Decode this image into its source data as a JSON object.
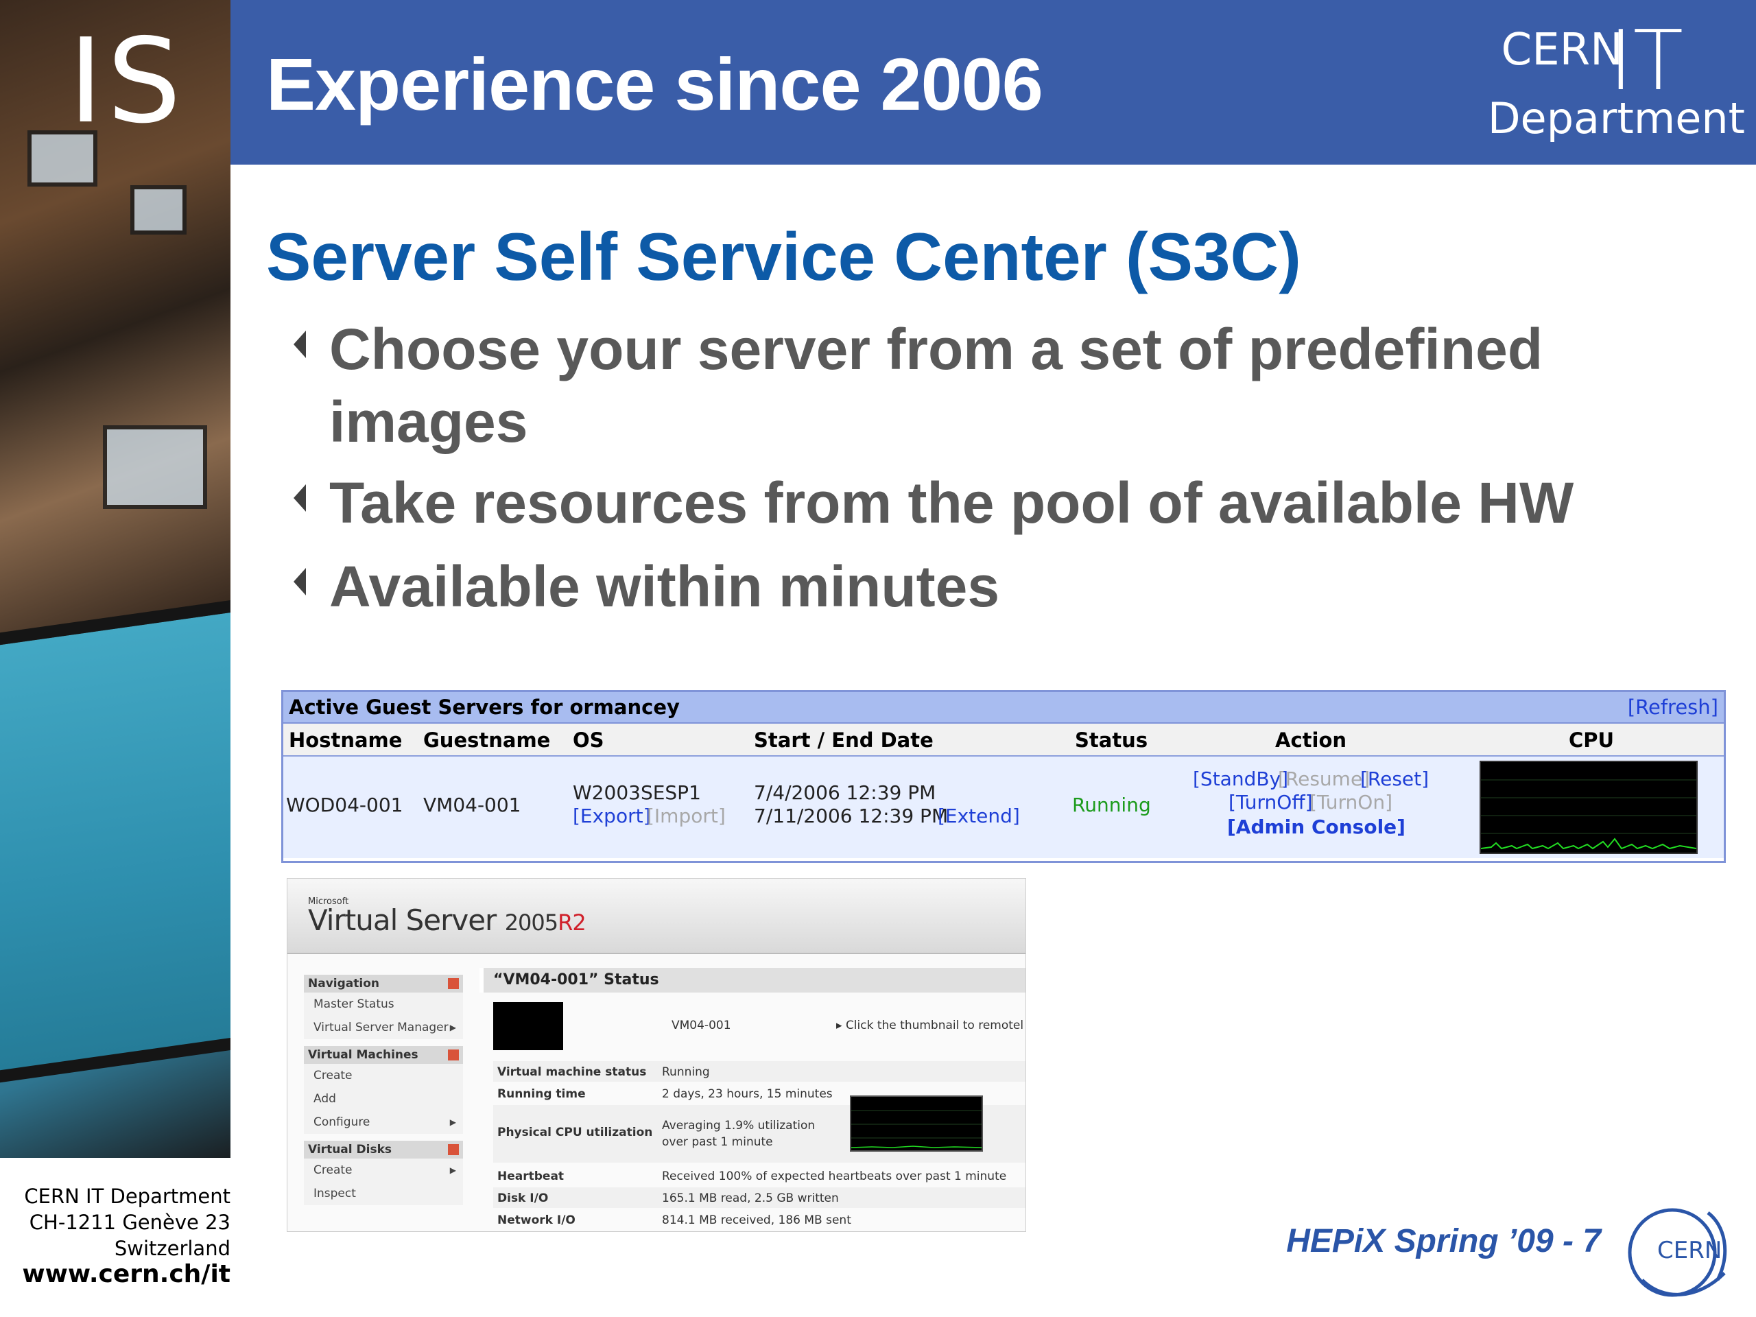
{
  "branding": {
    "is_logo": "IS",
    "cern_logo": {
      "cern": "CERN",
      "it": "IT",
      "department": "Department"
    },
    "emblem_text": "CERN"
  },
  "slide": {
    "title": "Experience since 2006",
    "subtitle": "Server Self Service Center (S3C)",
    "bullets": [
      "Choose your server from a set of predefined images",
      "Take resources from the pool of available HW",
      "Available within minutes"
    ]
  },
  "s3c_table": {
    "title": "Active Guest Servers for ormancey",
    "refresh_link": "[Refresh]",
    "columns": [
      "Hostname",
      "Guestname",
      "OS",
      "Start / End Date",
      "Status",
      "Action",
      "CPU"
    ],
    "row": {
      "hostname": "WOD04-001",
      "guestname": "VM04-001",
      "os": "W2003SESP1",
      "export": "[Export]",
      "import": "[Import]",
      "start_date": "7/4/2006 12:39 PM",
      "end_date": "7/11/2006 12:39 PM",
      "extend": "[Extend]",
      "status": "Running",
      "actions": {
        "standby": "[StandBy]",
        "resume": "[Resume]",
        "reset": "[Reset]",
        "turnoff": "[TurnOff]",
        "turnon": "[TurnOn]",
        "admin_console": "[Admin Console]"
      }
    },
    "colors": {
      "header_bg": "#a8bcf0",
      "row_bg": "#e8efff",
      "link": "#1e3fd6",
      "running": "#1c9b1c"
    }
  },
  "virtual_server": {
    "brand_small": "Microsoft",
    "product": "Virtual Server",
    "version": "2005",
    "release": "R2",
    "nav": {
      "sections": [
        {
          "label": "Navigation",
          "items": [
            "Master Status",
            "Virtual Server Manager"
          ]
        },
        {
          "label": "Virtual Machines",
          "items": [
            "Create",
            "Add",
            "Configure"
          ]
        },
        {
          "label": "Virtual Disks",
          "items": [
            "Create",
            "Inspect"
          ]
        }
      ]
    },
    "status_title": "“VM04-001” Status",
    "vm_label": "VM04-001",
    "thumbnail_hint": "Click the thumbnail to remotel",
    "details": [
      {
        "key": "Virtual machine status",
        "value": "Running"
      },
      {
        "key": "Running time",
        "value": "2 days, 23 hours, 15 minutes"
      },
      {
        "key": "Physical CPU utilization",
        "value": "Averaging 1.9% utilization over past 1 minute"
      },
      {
        "key": "Heartbeat",
        "value": "Received 100% of expected heartbeats over past 1 minute"
      },
      {
        "key": "Disk I/O",
        "value": "165.1 MB read, 2.5 GB written"
      },
      {
        "key": "Network I/O",
        "value": "814.1 MB received, 186 MB sent"
      }
    ]
  },
  "footer": {
    "address_line1": "CERN IT Department",
    "address_line2": "CH-1211 Genève 23",
    "address_line3": "Switzerland",
    "website": "www.cern.ch/it",
    "event": "HEPiX Spring ’09 - 7"
  }
}
